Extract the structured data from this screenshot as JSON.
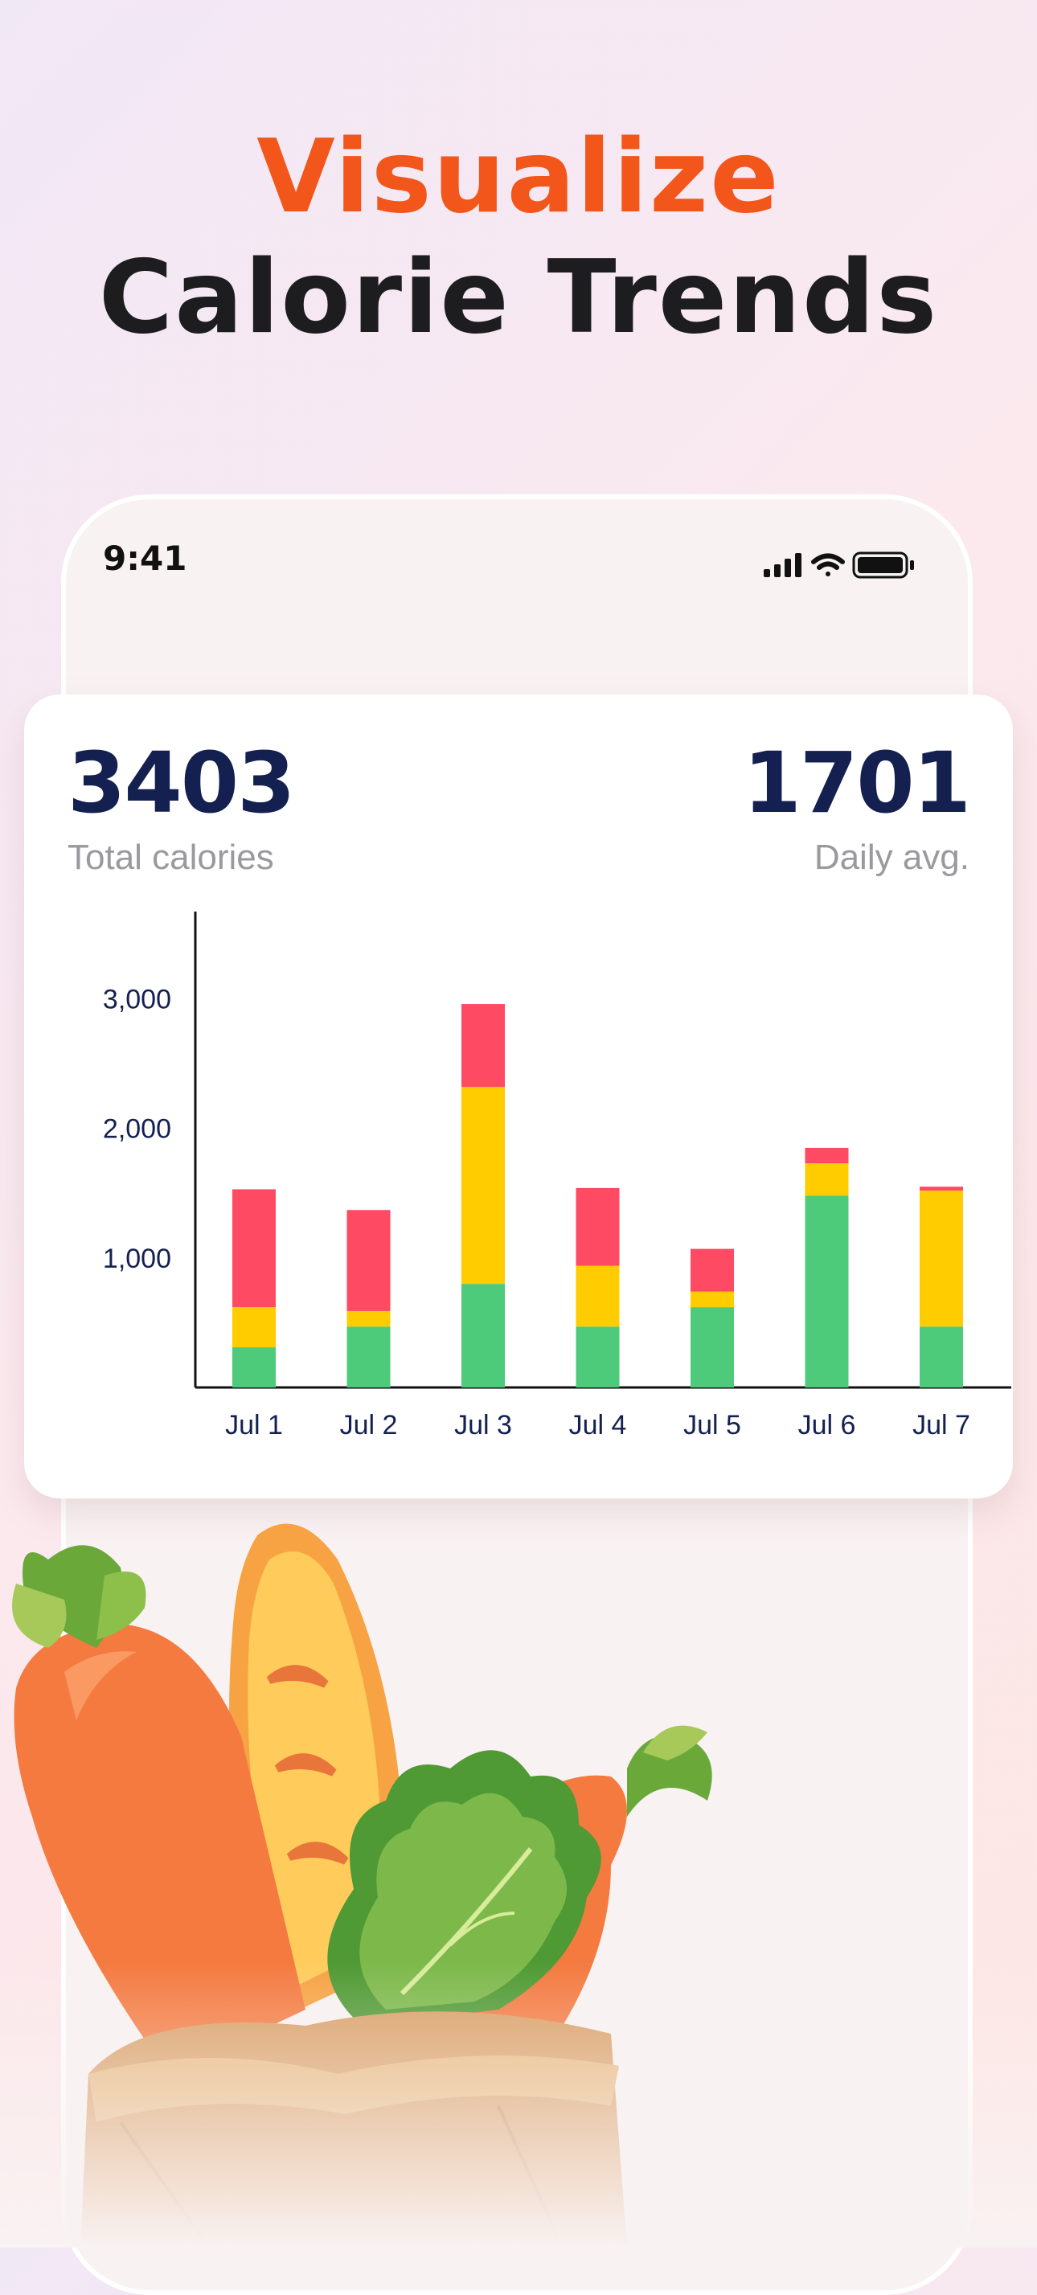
{
  "headline": {
    "line1": "Visualize",
    "line2": "Calorie Trends"
  },
  "status_bar": {
    "time": "9:41"
  },
  "stats": {
    "total_value": "3403",
    "total_label": "Total calories",
    "avg_value": "1701",
    "avg_label": "Daily avg."
  },
  "colors": {
    "accent": "#f2561b",
    "segment_green": "#4ecb7a",
    "segment_yellow": "#ffcc00",
    "segment_red": "#ff4a63",
    "number_navy": "#142050"
  },
  "chart_data": {
    "type": "bar",
    "stacked": true,
    "categories": [
      "Jul 1",
      "Jul 2",
      "Jul 3",
      "Jul 4",
      "Jul 5",
      "Jul 6",
      "Jul 7"
    ],
    "series": [
      {
        "color": "#4ecb7a",
        "values": [
          310,
          470,
          800,
          470,
          620,
          1480,
          470
        ]
      },
      {
        "color": "#ffcc00",
        "values": [
          310,
          120,
          1520,
          470,
          120,
          250,
          1050
        ]
      },
      {
        "color": "#ff4a63",
        "values": [
          910,
          780,
          640,
          600,
          330,
          120,
          30
        ]
      }
    ],
    "yticks": [
      "1,000",
      "2,000",
      "3,000"
    ],
    "ytick_values": [
      1000,
      2000,
      3000
    ],
    "ylim": [
      0,
      3550
    ],
    "grid": false
  }
}
